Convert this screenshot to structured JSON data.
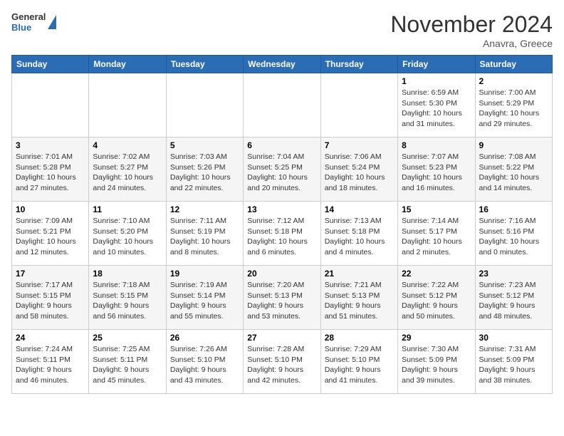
{
  "header": {
    "logo": {
      "general": "General",
      "blue": "Blue"
    },
    "month": "November 2024",
    "location": "Anavra, Greece"
  },
  "weekdays": [
    "Sunday",
    "Monday",
    "Tuesday",
    "Wednesday",
    "Thursday",
    "Friday",
    "Saturday"
  ],
  "weeks": [
    [
      {
        "day": "",
        "info": ""
      },
      {
        "day": "",
        "info": ""
      },
      {
        "day": "",
        "info": ""
      },
      {
        "day": "",
        "info": ""
      },
      {
        "day": "",
        "info": ""
      },
      {
        "day": "1",
        "info": "Sunrise: 6:59 AM\nSunset: 5:30 PM\nDaylight: 10 hours and 31 minutes."
      },
      {
        "day": "2",
        "info": "Sunrise: 7:00 AM\nSunset: 5:29 PM\nDaylight: 10 hours and 29 minutes."
      }
    ],
    [
      {
        "day": "3",
        "info": "Sunrise: 7:01 AM\nSunset: 5:28 PM\nDaylight: 10 hours and 27 minutes."
      },
      {
        "day": "4",
        "info": "Sunrise: 7:02 AM\nSunset: 5:27 PM\nDaylight: 10 hours and 24 minutes."
      },
      {
        "day": "5",
        "info": "Sunrise: 7:03 AM\nSunset: 5:26 PM\nDaylight: 10 hours and 22 minutes."
      },
      {
        "day": "6",
        "info": "Sunrise: 7:04 AM\nSunset: 5:25 PM\nDaylight: 10 hours and 20 minutes."
      },
      {
        "day": "7",
        "info": "Sunrise: 7:06 AM\nSunset: 5:24 PM\nDaylight: 10 hours and 18 minutes."
      },
      {
        "day": "8",
        "info": "Sunrise: 7:07 AM\nSunset: 5:23 PM\nDaylight: 10 hours and 16 minutes."
      },
      {
        "day": "9",
        "info": "Sunrise: 7:08 AM\nSunset: 5:22 PM\nDaylight: 10 hours and 14 minutes."
      }
    ],
    [
      {
        "day": "10",
        "info": "Sunrise: 7:09 AM\nSunset: 5:21 PM\nDaylight: 10 hours and 12 minutes."
      },
      {
        "day": "11",
        "info": "Sunrise: 7:10 AM\nSunset: 5:20 PM\nDaylight: 10 hours and 10 minutes."
      },
      {
        "day": "12",
        "info": "Sunrise: 7:11 AM\nSunset: 5:19 PM\nDaylight: 10 hours and 8 minutes."
      },
      {
        "day": "13",
        "info": "Sunrise: 7:12 AM\nSunset: 5:18 PM\nDaylight: 10 hours and 6 minutes."
      },
      {
        "day": "14",
        "info": "Sunrise: 7:13 AM\nSunset: 5:18 PM\nDaylight: 10 hours and 4 minutes."
      },
      {
        "day": "15",
        "info": "Sunrise: 7:14 AM\nSunset: 5:17 PM\nDaylight: 10 hours and 2 minutes."
      },
      {
        "day": "16",
        "info": "Sunrise: 7:16 AM\nSunset: 5:16 PM\nDaylight: 10 hours and 0 minutes."
      }
    ],
    [
      {
        "day": "17",
        "info": "Sunrise: 7:17 AM\nSunset: 5:15 PM\nDaylight: 9 hours and 58 minutes."
      },
      {
        "day": "18",
        "info": "Sunrise: 7:18 AM\nSunset: 5:15 PM\nDaylight: 9 hours and 56 minutes."
      },
      {
        "day": "19",
        "info": "Sunrise: 7:19 AM\nSunset: 5:14 PM\nDaylight: 9 hours and 55 minutes."
      },
      {
        "day": "20",
        "info": "Sunrise: 7:20 AM\nSunset: 5:13 PM\nDaylight: 9 hours and 53 minutes."
      },
      {
        "day": "21",
        "info": "Sunrise: 7:21 AM\nSunset: 5:13 PM\nDaylight: 9 hours and 51 minutes."
      },
      {
        "day": "22",
        "info": "Sunrise: 7:22 AM\nSunset: 5:12 PM\nDaylight: 9 hours and 50 minutes."
      },
      {
        "day": "23",
        "info": "Sunrise: 7:23 AM\nSunset: 5:12 PM\nDaylight: 9 hours and 48 minutes."
      }
    ],
    [
      {
        "day": "24",
        "info": "Sunrise: 7:24 AM\nSunset: 5:11 PM\nDaylight: 9 hours and 46 minutes."
      },
      {
        "day": "25",
        "info": "Sunrise: 7:25 AM\nSunset: 5:11 PM\nDaylight: 9 hours and 45 minutes."
      },
      {
        "day": "26",
        "info": "Sunrise: 7:26 AM\nSunset: 5:10 PM\nDaylight: 9 hours and 43 minutes."
      },
      {
        "day": "27",
        "info": "Sunrise: 7:28 AM\nSunset: 5:10 PM\nDaylight: 9 hours and 42 minutes."
      },
      {
        "day": "28",
        "info": "Sunrise: 7:29 AM\nSunset: 5:10 PM\nDaylight: 9 hours and 41 minutes."
      },
      {
        "day": "29",
        "info": "Sunrise: 7:30 AM\nSunset: 5:09 PM\nDaylight: 9 hours and 39 minutes."
      },
      {
        "day": "30",
        "info": "Sunrise: 7:31 AM\nSunset: 5:09 PM\nDaylight: 9 hours and 38 minutes."
      }
    ]
  ]
}
